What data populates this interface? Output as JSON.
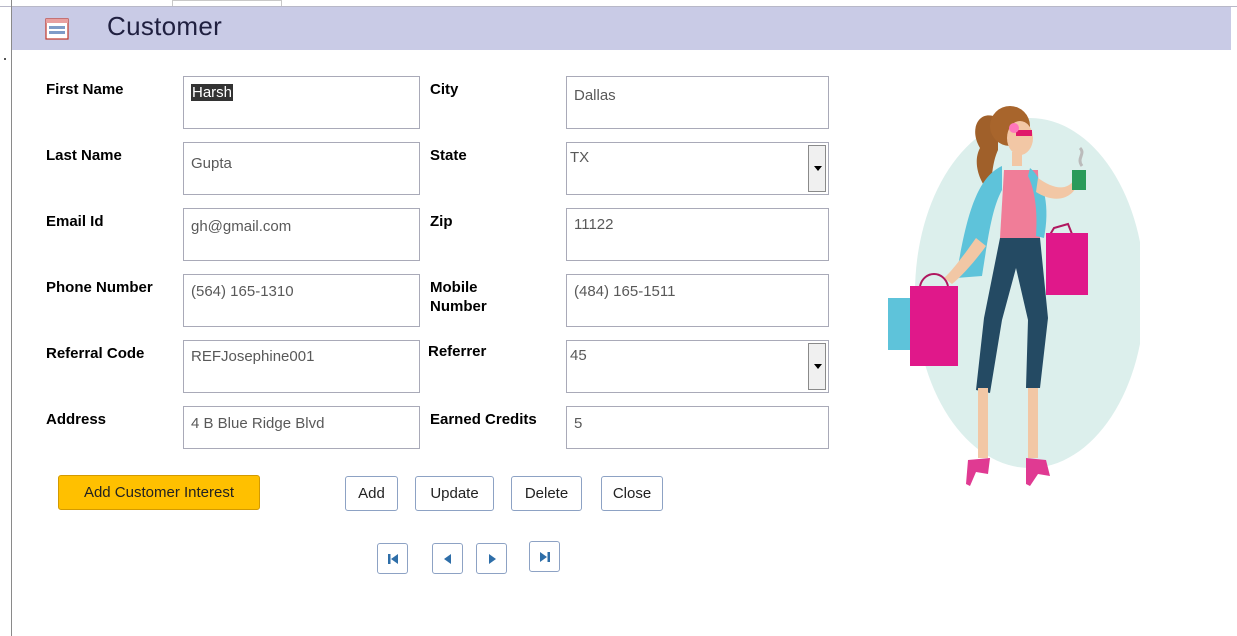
{
  "form": {
    "title": "Customer",
    "title_icon": "form-icon"
  },
  "fields": {
    "first_name": {
      "label": "First Name",
      "value": "Harsh"
    },
    "last_name": {
      "label": "Last Name",
      "value": "Gupta"
    },
    "email": {
      "label": "Email Id",
      "value": "gh@gmail.com"
    },
    "phone": {
      "label": "Phone Number",
      "value": "(564) 165-1310"
    },
    "referral_code": {
      "label": "Referral Code",
      "value": "REFJosephine001"
    },
    "address": {
      "label": "Address",
      "value": "4 B Blue Ridge Blvd"
    },
    "city": {
      "label": "City",
      "value": "Dallas"
    },
    "state": {
      "label": "State",
      "value": "TX"
    },
    "zip": {
      "label": "Zip",
      "value": "11122"
    },
    "mobile": {
      "label_line1": "Mobile",
      "label_line2": "Number",
      "value": "(484) 165-1511"
    },
    "referrer": {
      "label": "Referrer",
      "value": "45"
    },
    "earned_credits": {
      "label": "Earned Credits",
      "value": "5"
    }
  },
  "buttons": {
    "add_interest": "Add Customer Interest",
    "add": "Add",
    "update": "Update",
    "delete": "Delete",
    "close": "Close"
  },
  "navigation": {
    "icons": [
      "first-record-icon",
      "previous-record-icon",
      "next-record-icon",
      "last-record-icon"
    ]
  },
  "colors": {
    "header_bg": "#c9cbe6",
    "accent_button": "#ffc000"
  }
}
